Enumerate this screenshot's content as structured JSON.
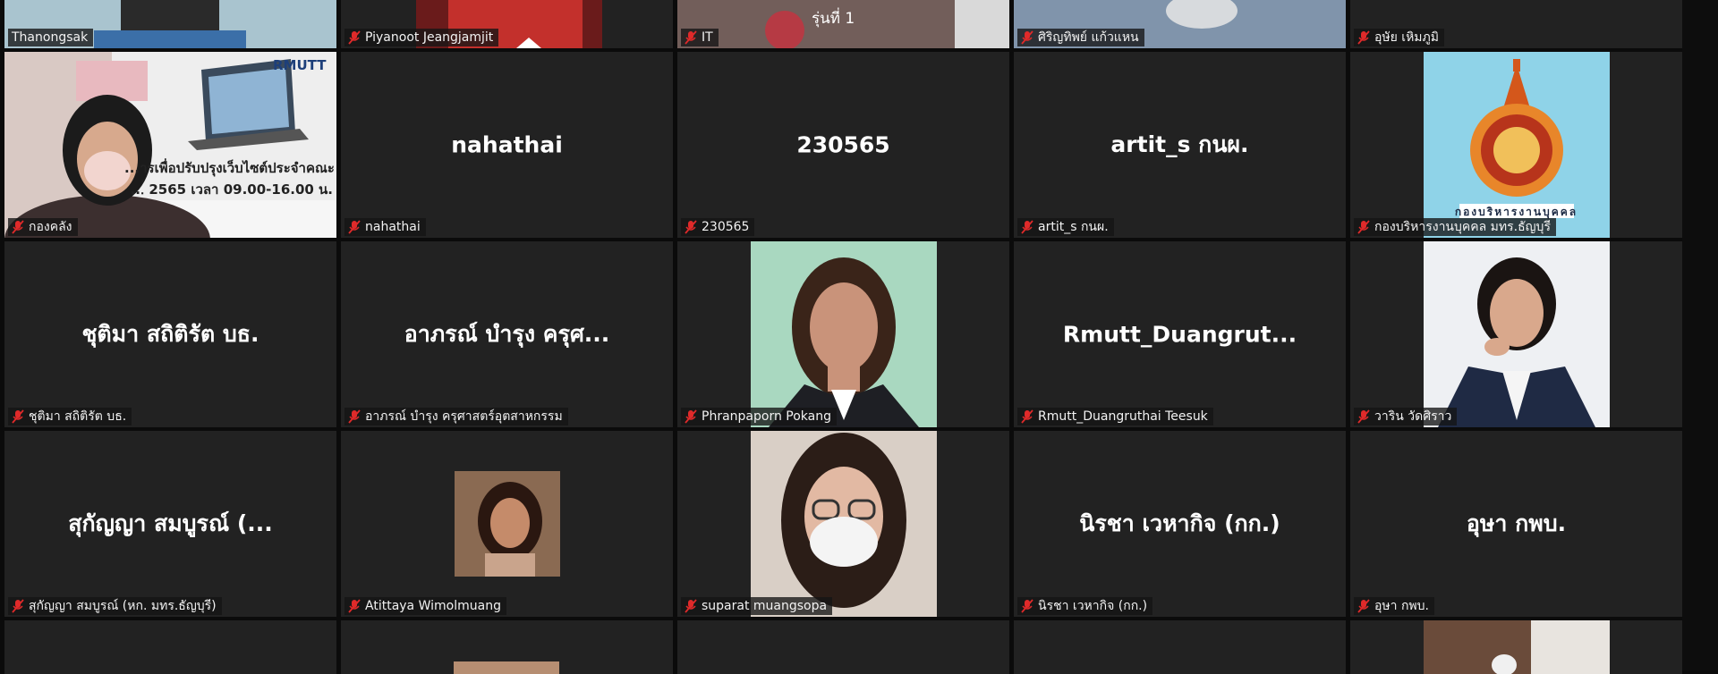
{
  "meeting": {
    "colors": {
      "tile_bg": "#222222",
      "active_speaker_border": "#d8d35a",
      "muted_mic": "#e02a2a"
    },
    "tiles": [
      {
        "id": "t1",
        "label": "Thanongsak",
        "mic": "none",
        "active": true,
        "center": "",
        "photo": "banner-video"
      },
      {
        "id": "t2",
        "label": "Piyanoot Jeangjamjit",
        "mic": "muted",
        "center": "",
        "photo": "person-red"
      },
      {
        "id": "t3",
        "label": "IT",
        "mic": "muted",
        "center": "",
        "photo": "room-video",
        "overlay_text": "รุ่นที่ 1"
      },
      {
        "id": "t4",
        "label": "ศิริญทิพย์ แก้วแหน",
        "mic": "muted",
        "center": "",
        "photo": "person-blue"
      },
      {
        "id": "t5",
        "label": "อุษัย เหิมภูมิ",
        "mic": "muted",
        "center": "",
        "photo": ""
      },
      {
        "id": "t6",
        "label": "กองคลัง",
        "mic": "muted",
        "center": "",
        "photo": "mask-woman-banner",
        "banner_logo": "RMUTT",
        "banner_line1": "...ารเพื่อปรับปรุงเว็บไซต์ประจำคณะ",
        "banner_line2": "...่ 2565 เวลา 09.00-16.00 น."
      },
      {
        "id": "t7",
        "label": "nahathai",
        "mic": "muted",
        "center": "nahathai",
        "photo": ""
      },
      {
        "id": "t8",
        "label": "230565",
        "mic": "muted",
        "center": "230565",
        "photo": ""
      },
      {
        "id": "t9",
        "label": "artit_s กนผ.",
        "mic": "muted",
        "center": "artit_s กนผ.",
        "photo": ""
      },
      {
        "id": "t10",
        "label": "กองบริหารงานบุคคล มทร.ธัญบุรี",
        "mic": "muted",
        "center": "",
        "photo": "logo",
        "logo_caption": "กองบริหารงานบุคคล"
      },
      {
        "id": "t11",
        "label": "ชุติมา  สถิติรัต  บธ.",
        "mic": "muted",
        "center": "ชุติมา  สถิติรัต  บธ.",
        "photo": ""
      },
      {
        "id": "t12",
        "label": "อาภรณ์ บำรุง ครุศาสตร์อุตสาหกรรม",
        "mic": "muted",
        "center": "อาภรณ์ บำรุง ครุศ...",
        "photo": ""
      },
      {
        "id": "t13",
        "label": "Phranpaporn Pokang",
        "mic": "muted",
        "center": "",
        "photo": "portrait-green"
      },
      {
        "id": "t14",
        "label": "Rmutt_Duangruthai Teesuk",
        "mic": "muted",
        "center": "Rmutt_Duangrut...",
        "photo": ""
      },
      {
        "id": "t15",
        "label": "วาริน วัดศิราว",
        "mic": "muted",
        "center": "",
        "photo": "portrait-white"
      },
      {
        "id": "t16",
        "label": "สุกัญญา สมบูรณ์ (หก. มทร.ธัญบุรี)",
        "mic": "muted",
        "center": "สุกัญญา สมบูรณ์ (...",
        "photo": ""
      },
      {
        "id": "t17",
        "label": "Atittaya Wimolmuang",
        "mic": "muted",
        "center": "",
        "photo": "small-photo"
      },
      {
        "id": "t18",
        "label": "suparat muangsopa",
        "mic": "muted",
        "center": "",
        "photo": "mask-glasses"
      },
      {
        "id": "t19",
        "label": "นิรชา  เวหากิจ (กก.)",
        "mic": "muted",
        "center": "นิรชา  เวหากิจ (กก.)",
        "photo": ""
      },
      {
        "id": "t20",
        "label": "อุษา กพบ.",
        "mic": "muted",
        "center": "อุษา กพบ.",
        "photo": ""
      },
      {
        "id": "t21",
        "label": "",
        "mic": "none",
        "center": "",
        "photo": ""
      },
      {
        "id": "t22",
        "label": "",
        "mic": "none",
        "center": "",
        "photo": "partial-top"
      },
      {
        "id": "t23",
        "label": "",
        "mic": "none",
        "center": "",
        "photo": ""
      },
      {
        "id": "t24",
        "label": "",
        "mic": "none",
        "center": "",
        "photo": ""
      },
      {
        "id": "t25",
        "label": "",
        "mic": "none",
        "center": "",
        "photo": "partial-room"
      }
    ]
  }
}
